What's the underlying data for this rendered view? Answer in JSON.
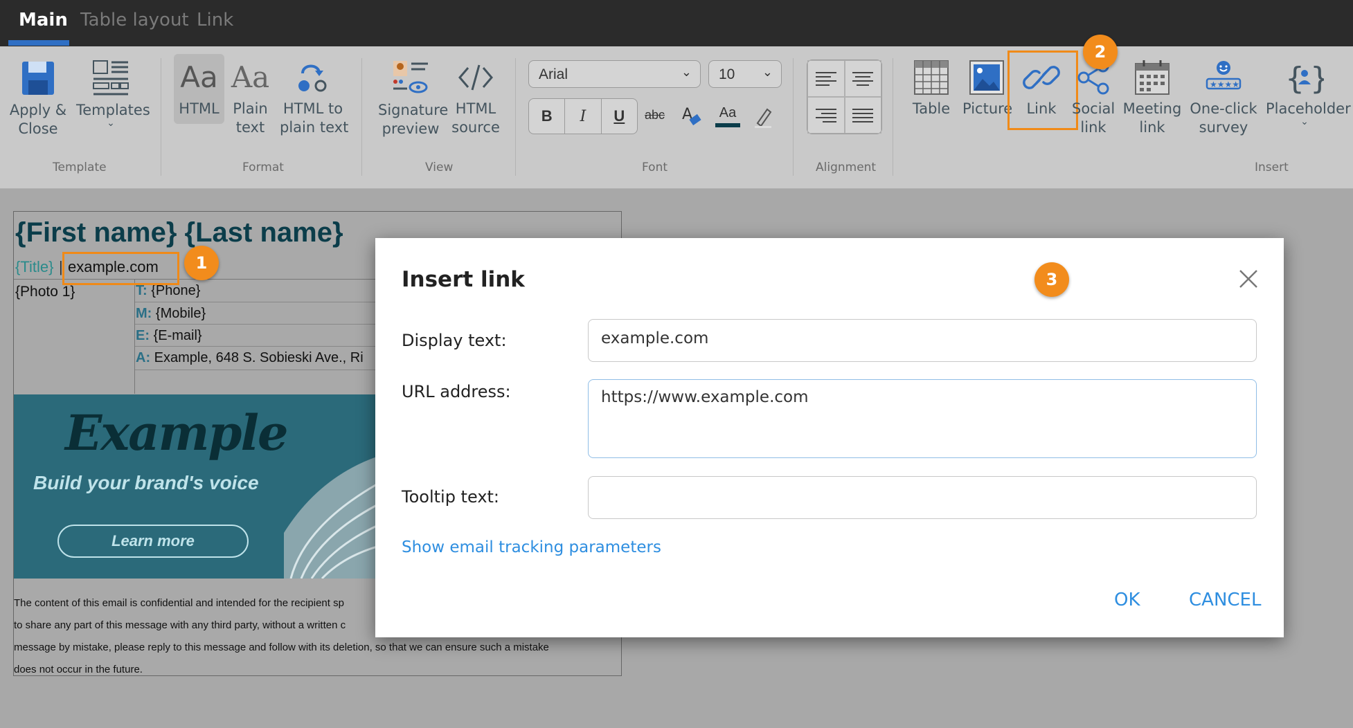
{
  "tabs": [
    {
      "label": "Main",
      "active": true
    },
    {
      "label": "Table layout",
      "active": false
    },
    {
      "label": "Link",
      "active": false
    }
  ],
  "ribbon": {
    "template": {
      "group_label": "Template",
      "apply_close": "Apply &\nClose",
      "templates": "Templates"
    },
    "format": {
      "group_label": "Format",
      "html": "HTML",
      "plain_text": "Plain\ntext",
      "html_to_plain": "HTML to\nplain text"
    },
    "view": {
      "group_label": "View",
      "signature_preview": "Signature\npreview",
      "html_source": "HTML\nsource"
    },
    "font": {
      "group_label": "Font",
      "family": "Arial",
      "size": "10",
      "bold": "B",
      "italic": "I",
      "underline": "U",
      "strike": "abc",
      "color_sample": "Aa",
      "font_color": "#0b3d4a"
    },
    "alignment": {
      "group_label": "Alignment"
    },
    "insert": {
      "group_label": "Insert",
      "table": "Table",
      "picture": "Picture",
      "link": "Link",
      "social_link": "Social\nlink",
      "meeting_link": "Meeting\nlink",
      "survey": "One-click\nsurvey",
      "placeholder": "Placeholder"
    }
  },
  "signature": {
    "name": "{First name} {Last name}",
    "title": "{Title}",
    "separator": "|",
    "website": "example.com",
    "photo": "{Photo 1}",
    "contacts": [
      {
        "key": "T:",
        "value": "{Phone}"
      },
      {
        "key": "M:",
        "value": "{Mobile}"
      },
      {
        "key": "E:",
        "value": "{E-mail}"
      },
      {
        "key": "A:",
        "value": "Example, 648 S. Sobieski Ave., Ri"
      }
    ],
    "banner": {
      "brand": "Example",
      "tagline": "Build your brand's voice",
      "cta": "Learn more"
    },
    "disclaimer_lines": [
      "The content of this email is confidential and intended for the recipient sp",
      "to share any part of this message with any third party, without a written c",
      "message by mistake, please reply to this message and follow with its deletion, so that we can ensure such a mistake",
      "does not occur in the future."
    ]
  },
  "badges": [
    "1",
    "2",
    "3"
  ],
  "dialog": {
    "title": "Insert link",
    "display_text_label": "Display text:",
    "display_text_value": "example.com",
    "url_label": "URL address:",
    "url_value": "https://www.example.com",
    "tooltip_label": "Tooltip text:",
    "tooltip_value": "",
    "tracking_link": "Show email tracking parameters",
    "ok": "OK",
    "cancel": "CANCEL"
  },
  "colors": {
    "accent": "#2e8ee0",
    "highlight": "#f08a18",
    "badge": "#f28c1c",
    "name_color": "#0b3d4a",
    "title_color": "#2a8b8b"
  }
}
